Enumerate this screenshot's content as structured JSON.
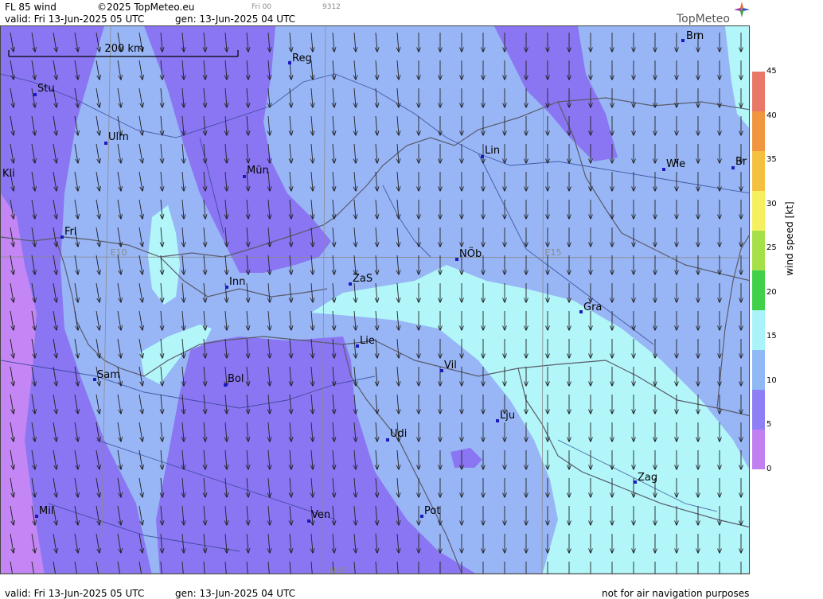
{
  "header": {
    "product": "FL 85 wind",
    "copyright": "©2025 TopMeteo.eu",
    "run": "Fri 00",
    "code": "9312",
    "valid": "valid:  Fri  13-Jun-2025  05 UTC",
    "gen": "gen: 13-Jun-2025 04 UTC"
  },
  "logo": {
    "text": "TopMeteo",
    "icon": "compass-star-icon"
  },
  "scale_bar": {
    "label": "200 km"
  },
  "grid_labels": [
    {
      "name": "grid-label-e10",
      "text": "E10"
    },
    {
      "name": "grid-label-e15",
      "text": "E15"
    },
    {
      "name": "grid-label-n45",
      "text": "N45"
    }
  ],
  "cities": [
    {
      "label": "Reg"
    },
    {
      "label": "Brn"
    },
    {
      "label": "Stu"
    },
    {
      "label": "Ulm"
    },
    {
      "label": "Lin"
    },
    {
      "label": "Kli"
    },
    {
      "label": "Mün"
    },
    {
      "label": "Wie"
    },
    {
      "label": "Br"
    },
    {
      "label": "Fri"
    },
    {
      "label": "NÖb"
    },
    {
      "label": "Inn"
    },
    {
      "label": "ZaS"
    },
    {
      "label": "Gra"
    },
    {
      "label": "Lie"
    },
    {
      "label": "Vil"
    },
    {
      "label": "Sam"
    },
    {
      "label": "Bol"
    },
    {
      "label": "Lju"
    },
    {
      "label": "Udi"
    },
    {
      "label": "Zag"
    },
    {
      "label": "Mil"
    },
    {
      "label": "Ven"
    },
    {
      "label": "Pot"
    }
  ],
  "legend": {
    "title": "wind  speed  [kt]",
    "unit": "kt",
    "min": 0,
    "max": 45,
    "ticks": [
      "45",
      "40",
      "35",
      "30",
      "25",
      "20",
      "15",
      "10",
      "5",
      "0"
    ],
    "colors": [
      "#c080f0",
      "#8f7ff5",
      "#8fb8f5",
      "#a8f4f8",
      "#40d04a",
      "#a6e048",
      "#f5f060",
      "#f5c040",
      "#f09540",
      "#e87868"
    ]
  },
  "wind_field_colors": {
    "purple": "#8a76f2",
    "light_blue": "#98b6f6",
    "cyan": "#b2f6fa",
    "lilac": "#c386f4"
  },
  "footer": {
    "valid": "valid:  Fri  13-Jun-2025  05 UTC",
    "gen": "gen: 13-Jun-2025 04 UTC",
    "note": "not for air navigation purposes"
  }
}
